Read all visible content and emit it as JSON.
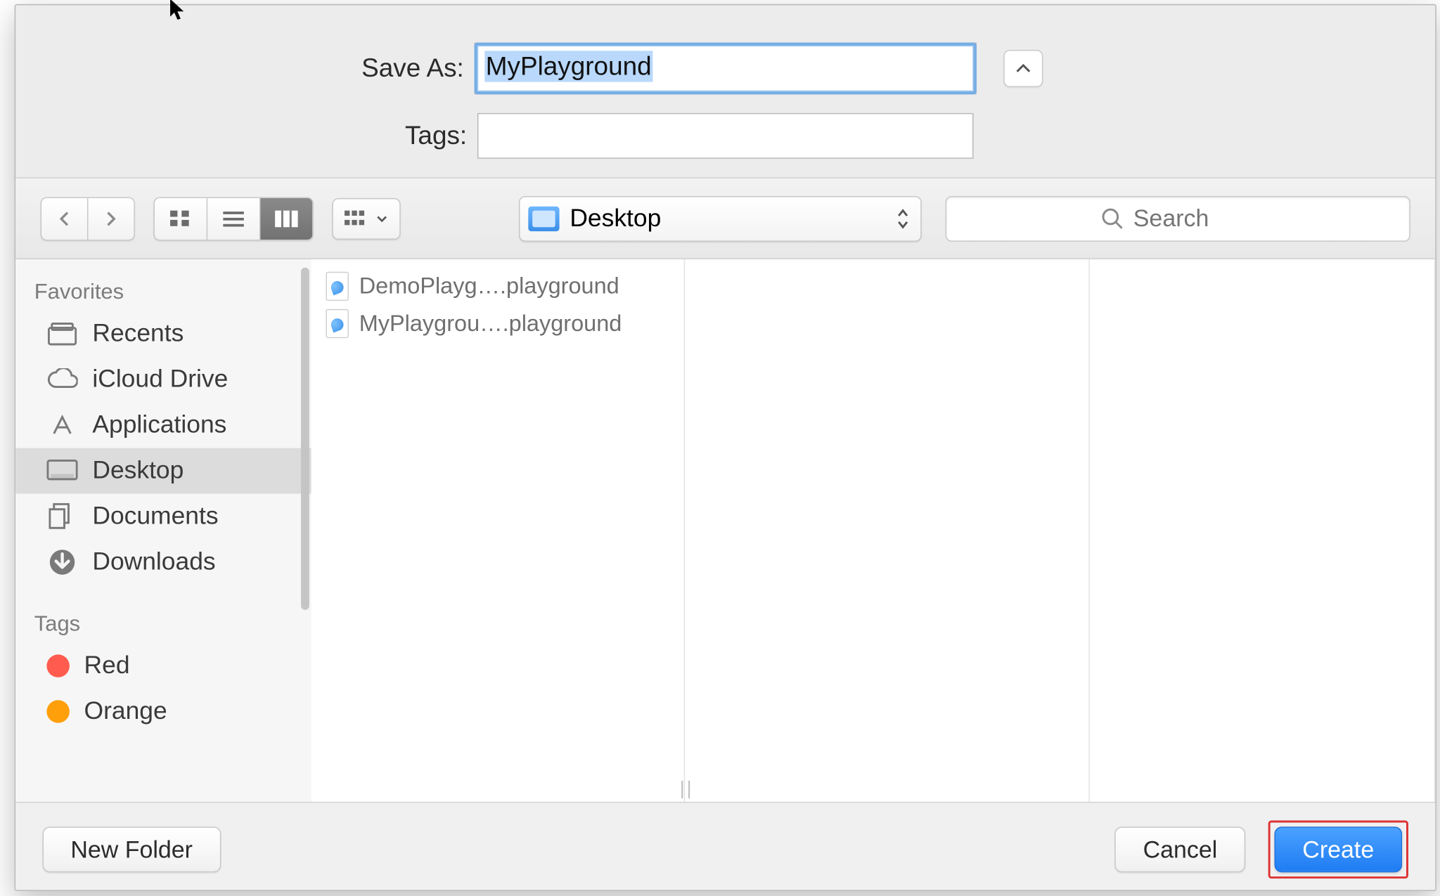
{
  "form": {
    "save_as_label": "Save As:",
    "save_as_value": "MyPlayground",
    "tags_label": "Tags:",
    "tags_value": ""
  },
  "toolbar": {
    "location_label": "Desktop",
    "search_placeholder": "Search"
  },
  "sidebar": {
    "favorites_header": "Favorites",
    "items": [
      {
        "icon": "recents",
        "label": "Recents",
        "selected": false
      },
      {
        "icon": "icloud",
        "label": "iCloud Drive",
        "selected": false
      },
      {
        "icon": "apps",
        "label": "Applications",
        "selected": false
      },
      {
        "icon": "desktop",
        "label": "Desktop",
        "selected": true
      },
      {
        "icon": "docs",
        "label": "Documents",
        "selected": false
      },
      {
        "icon": "down",
        "label": "Downloads",
        "selected": false
      }
    ],
    "tags_header": "Tags",
    "tags": [
      {
        "color": "#ff5b4e",
        "label": "Red"
      },
      {
        "color": "#ff9f0a",
        "label": "Orange"
      }
    ]
  },
  "files": [
    {
      "name": "DemoPlayg….playground"
    },
    {
      "name": "MyPlaygrou….playground"
    }
  ],
  "footer": {
    "new_folder_label": "New Folder",
    "cancel_label": "Cancel",
    "create_label": "Create"
  }
}
